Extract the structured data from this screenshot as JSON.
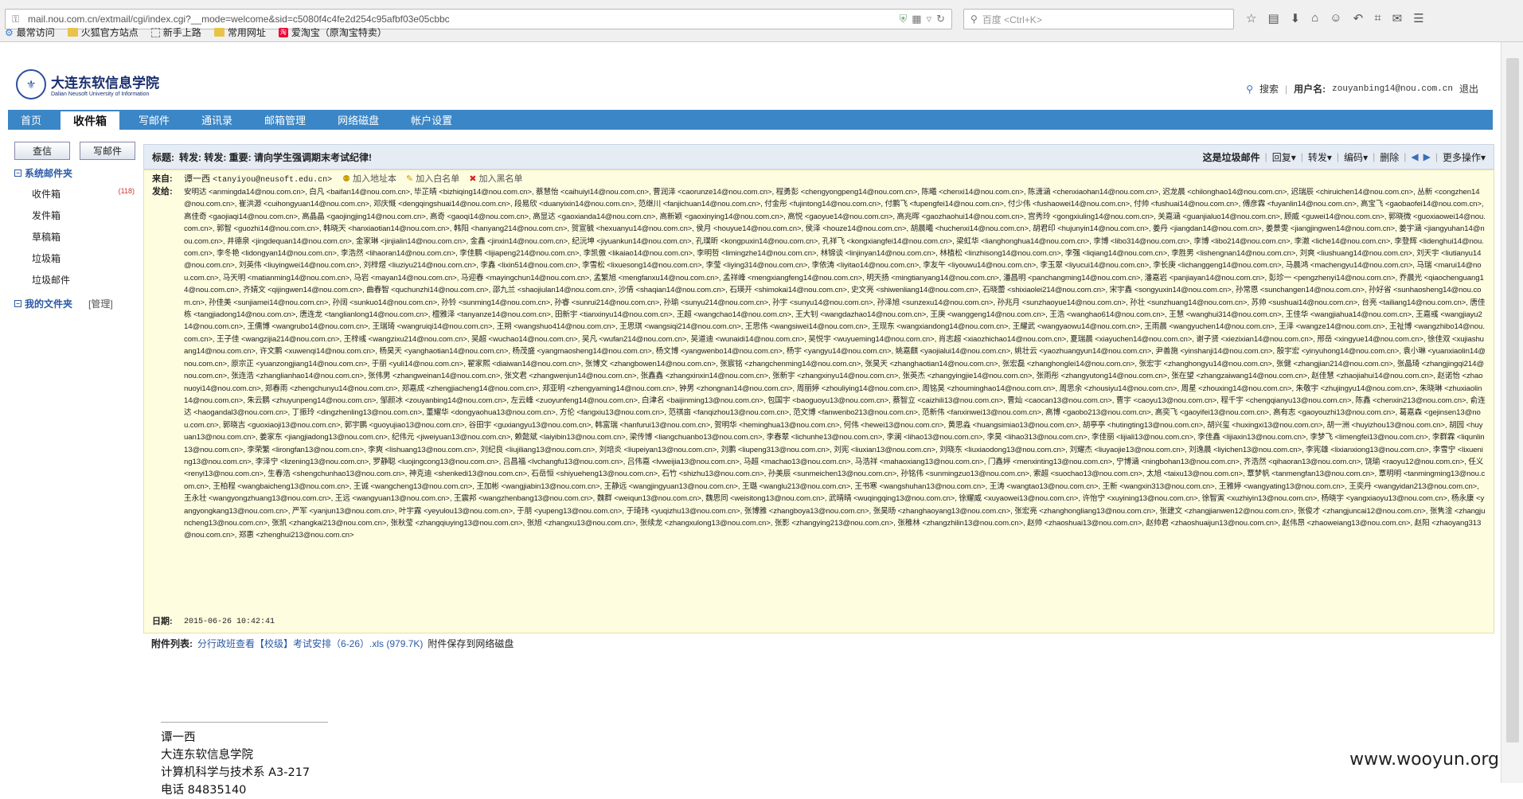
{
  "browser": {
    "url": "mail.nou.com.cn/extmail/cgi/index.cgi?__mode=welcome&sid=c5080f4c4fe2d254c95afbf03e05cbbc",
    "search_placeholder": "百度 <Ctrl+K>",
    "bookmarks": [
      "最常访问",
      "火狐官方站点",
      "新手上路",
      "常用网址",
      "爱淘宝（原淘宝特卖）"
    ]
  },
  "site": {
    "logo_cn": "大连东软信息学院",
    "logo_en": "Dalian Neusoft University of Information",
    "search_label": "搜索",
    "user_label": "用户名:",
    "username": "zouyanbing14@nou.com.cn",
    "logout": "退出"
  },
  "nav": {
    "tabs": [
      "首页",
      "收件箱",
      "写邮件",
      "通讯录",
      "邮箱管理",
      "网络磁盘",
      "帐户设置"
    ]
  },
  "sidebar": {
    "check_btn": "查信",
    "compose_btn": "写邮件",
    "system_title": "系统邮件夹",
    "folders": [
      {
        "name": "收件箱",
        "count": "(118)"
      },
      {
        "name": "发件箱",
        "count": ""
      },
      {
        "name": "草稿箱",
        "count": ""
      },
      {
        "name": "垃圾箱",
        "count": ""
      },
      {
        "name": "垃圾邮件",
        "count": ""
      }
    ],
    "my_title": "我的文件夹",
    "manage": "[管理]"
  },
  "mail": {
    "subject_label": "标题:",
    "subject": "转发: 转发: 重要: 请向学生强调期末考试纪律!",
    "tools": {
      "spam": "这是垃圾邮件",
      "reply": "回复",
      "forward": "转发",
      "encoding": "编码",
      "delete": "删除",
      "more": "更多操作"
    },
    "from_label": "来自:",
    "from_name": "谭一西",
    "from_email": "<tanyiyou@neusoft.edu.cn>",
    "add_contact": "加入地址本",
    "add_white": "加入白名单",
    "add_black": "加入黑名单",
    "to_label": "发给:",
    "recipients_text": "安明达 <anmingda14@nou.com.cn>, 白凡 <baifan14@nou.com.cn>, 毕芷晴 <bizhiqing14@nou.com.cn>, 蔡慧怡 <caihuiyi14@nou.com.cn>, 曹润泽 <caorunze14@nou.com.cn>, 程勇彭 <chengyongpeng14@nou.com.cn>, 陈曦 <chenxi14@nou.com.cn>, 陈潇涵 <chenxiaohan14@nou.com.cn>, 迟龙晨 <chilonghao14@nou.com.cn>, 迟瑞辰 <chiruichen14@nou.com.cn>, 丛新 <congzhen14@nou.com.cn>, 崔洪源 <cuihongyuan14@nou.com.cn>, 邓庆慨 <dengqingshuai14@nou.com.cn>, 段易欣 <duanyixin14@nou.com.cn>, 范继川 <fanjichuan14@nou.com.cn>, 付金彤 <fujintong14@nou.com.cn>, 付鹏飞 <fupengfei14@nou.com.cn>, 付少伟 <fushaowei14@nou.com.cn>, 付帅 <fushuai14@nou.com.cn>, 傅彦霖 <fuyanlin14@nou.com.cn>, 高宝飞 <gaobaofei14@nou.com.cn>, 高佳奇 <gaojiaqi14@nou.com.cn>, 高晶晶 <gaojingjing14@nou.com.cn>, 高奇 <gaoqi14@nou.com.cn>, 高显达 <gaoxianda14@nou.com.cn>, 高新颖 <gaoxinying14@nou.com.cn>, 高悦 <gaoyue14@nou.com.cn>, 高兆晖 <gaozhaohui14@nou.com.cn>, 宫秀玲 <gongxiuling14@nou.com.cn>, 关嘉涵 <guanjialuo14@nou.com.cn>, 顾威 <guwei14@nou.com.cn>, 郭晓微 <guoxiaowei14@nou.com.cn>, 郭智 <guozhi14@nou.com.cn>, 韩晓天 <hanxiaotian14@nou.com.cn>, 韩阳 <hanyang214@nou.com.cn>, 贺宣毓 <hexuanyu14@nou.com.cn>, 侯月 <houyue14@nou.com.cn>, 侯泽 <houze14@nou.com.cn>, 胡晨曦 <huchenxi14@nou.com.cn>, 胡君印 <hujunyin14@nou.com.cn>, 姜丹 <jiangdan14@nou.com.cn>, 姜景雯 <jiangjingwen14@nou.com.cn>, 姜宇涵 <jiangyuhan14@nou.com.cn>, 井德泉 <jingdequan14@nou.com.cn>, 金家琳 <jinjialin14@nou.com.cn>, 金鑫 <jinxin14@nou.com.cn>, 纪沅坤 <jiyuankun14@nou.com.cn>, 孔璞昕 <kongpuxin14@nou.com.cn>, 孔祥飞 <kongxiangfei14@nou.com.cn>, 梁虹华 <lianghonghua14@nou.com.cn>, 李博 <libo314@nou.com.cn>, 李博 <libo214@nou.com.cn>, 李澈 <liche14@nou.com.cn>, 李登辉 <lidenghui14@nou.com.cn>, 李冬艳 <lidongyan14@nou.com.cn>, 李浩然 <lihaoran14@nou.com.cn>, 李佳鹏 <lijiapeng214@nou.com.cn>, 李凯傲 <likaiao14@nou.com.cn>, 李明哲 <limingzhe14@nou.com.cn>, 林锦谈 <linjinyan14@nou.com.cn>, 林植松 <linzhisong14@nou.com.cn>, 李强 <liqiang14@nou.com.cn>, 李胜男 <lishengnan14@nou.com.cn>, 刘爽 <liushuang14@nou.com.cn>, 刘天宇 <liutianyu14@nou.com.cn>, 刘英伟 <liuyingwei14@nou.com.cn>, 刘梓煜 <liuziyu214@nou.com.cn>, 李鑫 <lixin514@nou.com.cn>, 李雪松 <lixuesong14@nou.com.cn>, 李莹 <liying314@nou.com.cn>, 李依涛 <liyitao14@nou.com.cn>, 李友午 <liyouwu14@nou.com.cn>, 李玉翠 <liyucui14@nou.com.cn>, 李长庚 <lichanggeng14@nou.com.cn>, 马晨鸿 <machengyu14@nou.com.cn>, 马瑞 <marui14@nou.com.cn>, 马天明 <matianming14@nou.com.cn>, 马岩 <mayan14@nou.com.cn>, 马迎春 <mayingchun14@nou.com.cn>, 孟繁旭 <mengfanxu14@nou.com.cn>, 孟祥峰 <mengxiangfeng14@nou.com.cn>, 明天扬 <mingtianyang14@nou.com.cn>, 潘昌明 <panchangming14@nou.com.cn>, 潘嘉岩 <panjiayan14@nou.com.cn>, 彭珍一 <pengzhenyi14@nou.com.cn>, 乔晨光 <qiaochenguang14@nou.com.cn>, 齐婧文 <qijingwen14@nou.com.cn>, 曲春智 <quchunzhi14@nou.com.cn>, 邵九兰 <shaojiulan14@nou.com.cn>, 沙倩 <shaqian14@nou.com.cn>, 石瑛开 <shimokai14@nou.com.cn>, 史文亮 <shiwenliang14@nou.com.cn>, 石晓蕾 <shixiaolei214@nou.com.cn>, 宋宇鑫 <songyuxin14@nou.com.cn>, 孙常恩 <sunchangen14@nou.com.cn>, 孙好省 <sunhaosheng14@nou.com.cn>, 孙佳美 <sunjiamei14@nou.com.cn>, 孙阔 <sunkuo14@nou.com.cn>, 孙铃 <sunming14@nou.com.cn>, 孙睿 <sunrui214@nou.com.cn>, 孙瑜 <sunyu214@nou.com.cn>, 孙宇 <sunyu14@nou.com.cn>, 孙泽旭 <sunzexu14@nou.com.cn>, 孙兆月 <sunzhaoyue14@nou.com.cn>, 孙壮 <sunzhuang14@nou.com.cn>, 苏帅 <sushuai14@nou.com.cn>, 台亮 <tailiang14@nou.com.cn>, 唐佳栋 <tangjiadong14@nou.com.cn>, 唐连龙 <tanglianlong14@nou.com.cn>, 檀雅泽 <tanyanze14@nou.com.cn>, 田新宇 <tianxinyu14@nou.com.cn>, 王超 <wangchao14@nou.com.cn>, 王大钊 <wangdazhao14@nou.com.cn>, 王庚 <wanggeng14@nou.com.cn>, 王浩 <wanghao614@nou.com.cn>, 王慧 <wanghui314@nou.com.cn>, 王佳华 <wangjiahua14@nou.com.cn>, 王嘉彧 <wangjiayu214@nou.com.cn>, 王儒博 <wangrubo14@nou.com.cn>, 王瑞琦 <wangruiqi14@nou.com.cn>, 王朔 <wangshuo414@nou.com.cn>, 王思琪 <wangsiqi214@nou.com.cn>, 王思伟 <wangsiwei14@nou.com.cn>, 王现东 <wangxiandong14@nou.com.cn>, 王耀武 <wangyaowu14@nou.com.cn>, 王雨晨 <wangyuchen14@nou.com.cn>, 王泽 <wangze14@nou.com.cn>, 王祉博 <wangzhibo14@nou.com.cn>, 王子佳 <wangzijia214@nou.com.cn>, 王梓彧 <wangzixu214@nou.com.cn>, 吴超 <wuchao14@nou.com.cn>, 吴凡 <wufan214@nou.com.cn>, 吴道迪 <wunaidi14@nou.com.cn>, 吴悦宇 <wuyueming14@nou.com.cn>, 肖志超 <xiaozhichao14@nou.com.cn>, 夏瑞晨 <xiayuchen14@nou.com.cn>, 谢子贤 <xiezixian14@nou.com.cn>, 邢岳 <xingyue14@nou.com.cn>, 徐佳双 <xujiashuang14@nou.com.cn>, 许文鹏 <xuwenqi14@nou.com.cn>, 杨昊天 <yanghaotian14@nou.com.cn>, 杨茂盛 <yangmaosheng14@nou.com.cn>, 杨文博 <yangwenbo14@nou.com.cn>, 杨宇 <yangyu14@nou.com.cn>, 姚嘉麒 <yaojialui14@nou.com.cn>, 姚壮云 <yaozhuangyun14@nou.com.cn>, 尹善施 <yinshanji14@nou.com.cn>, 殷宇宏 <yinyuhong14@nou.com.cn>, 袁小琳 <yuanxiaolin14@nou.com.cn>, 原宗正 <yuanzongjiang14@nou.com.cn>, 于丽 <yuli14@nou.com.cn>, 翟家熙 <diaiwan14@nou.com.cn>, 张博文 <zhangbowen14@nou.com.cn>, 张宸铭 <zhangchenming14@nou.com.cn>, 张昊天 <zhanghaotian14@nou.com.cn>, 张宏磊 <zhanghonglei14@nou.com.cn>, 张宏宇 <zhanghongyu14@nou.com.cn>, 张健 <zhangjian214@nou.com.cn>, 张晶琦 <zhangjingqi214@nou.com.cn>, 张连浩 <zhanglianhao14@nou.com.cn>, 张伟男 <zhangweinan14@nou.com.cn>, 张文君 <zhangwenjun14@nou.com.cn>, 张鑫鑫 <zhangxinxin14@nou.com.cn>, 张新宇 <zhangxinyu14@nou.com.cn>, 张英杰 <zhangyingjie14@nou.com.cn>, 张雨彤 <zhangyutong14@nou.com.cn>, 张在望 <zhangzaiwang14@nou.com.cn>, 赵佳慧 <zhaojiahui14@nou.com.cn>, 赵诺怡 <zhaonuoyi14@nou.com.cn>, 郑春雨 <zhengchunyu14@nou.com.cn>, 郑嘉成 <zhengjiacheng14@nou.com.cn>, 郑亚明 <zhengyaming14@nou.com.cn>, 钟男 <zhongnan14@nou.com.cn>, 周丽婷 <zhouliying14@nou.com.cn>, 周铭昊 <zhouminghao14@nou.com.cn>, 周思余 <zhousiyu14@nou.com.cn>, 周星 <zhouxing14@nou.com.cn>, 朱敬宇 <zhujingyu14@nou.com.cn>, 朱晓琳 <zhuxiaolin14@nou.com.cn>, 朱云鹏 <zhuyunpeng14@nou.com.cn>, 邹颜冰 <zouyanbing14@nou.com.cn>, 左云峰 <zuoyunfeng14@nou.com.cn>, 白津名 <baijinming13@nou.com.cn>, 包国宇 <baoguoyu13@nou.com.cn>, 蔡智立 <caizhili13@nou.com.cn>, 曹灿 <caocan13@nou.com.cn>, 曹宇 <caoyu13@nou.com.cn>, 程千宇 <chengqianyu13@nou.com.cn>, 陈鑫 <chenxin213@nou.com.cn>, 俞连达 <haogandal3@nou.com.cn>, 丁振玲 <dingzhenling13@nou.com.cn>, 董耀华 <dongyaohua13@nou.com.cn>, 方伦 <fangxiu13@nou.com.cn>, 范祺亩 <fanqizhou13@nou.com.cn>, 范文博 <fanwenbo213@nou.com.cn>, 范新伟 <fanxinwei13@nou.com.cn>, 高博 <gaobo213@nou.com.cn>, 高奕飞 <gaoyifei13@nou.com.cn>, 高有志 <gaoyouzhi13@nou.com.cn>, 葛嘉森 <gejinsen13@nou.com.cn>, 郭晓吉 <guoxiaoji13@nou.com.cn>, 郭宇鹏 <guoyujiao13@nou.com.cn>, 谷田宇 <guxiangyu13@nou.com.cn>, 韩富瑞 <hanfurui13@nou.com.cn>, 贺明华 <heminghua13@nou.com.cn>, 何伟 <hewei13@nou.com.cn>, 黄思淼 <huangsimiao13@nou.com.cn>, 胡亭亭 <hutingting13@nou.com.cn>, 胡兴玺 <huxingxi13@nou.com.cn>, 胡一洲 <huyizhou13@nou.com.cn>, 胡园 <huyuan13@nou.com.cn>, 姜家东 <jiangjiadong13@nou.com.cn>, 纪伟元 <jiweiyuan13@nou.com.cn>, 赖懿斌 <laiyibin13@nou.com.cn>, 梁传博 <liangchuanbo13@nou.com.cn>, 李春翠 <lichunhe13@nou.com.cn>, 李澜 <lihao13@nou.com.cn>, 李昊 <lihao313@nou.com.cn>, 李佳丽 <lijiali13@nou.com.cn>, 李佳鑫 <lijiaxin13@nou.com.cn>, 李梦飞 <limengfei13@nou.com.cn>, 李群霖 <liqunlin13@nou.com.cn>, 李荣繁 <lirongfan13@nou.com.cn>, 李爽 <lishuang13@nou.com.cn>, 刘纪良 <liujiliang13@nou.com.cn>, 刘培炎 <liupeiyan13@nou.com.cn>, 刘鹏 <liupeng313@nou.com.cn>, 刘宪 <liuxian13@nou.com.cn>, 刘晓东 <liuxiaodong13@nou.com.cn>, 刘耀杰 <liuyaojie13@nou.com.cn>, 刘逸晨 <liyichen13@nou.com.cn>, 李宪雄 <lixianxiong13@nou.com.cn>, 李雪宁 <lixuening13@nou.com.cn>, 李泽宁 <lizening13@nou.com.cn>, 罗静聪 <luojingcong13@nou.com.cn>, 吕昌福 <lvchangfu13@nou.com.cn>, 吕伟嘉 <lvweijia13@nou.com.cn>, 马超 <machao13@nou.com.cn>, 马浩祥 <mahaoxiang13@nou.com.cn>, 门鑫婷 <menxinting13@nou.com.cn>, 宁博涵 <ningbohan13@nou.com.cn>, 齐浩然 <qihaoran13@nou.com.cn>, 饶瑜 <raoyu12@nou.com.cn>, 任义 <renyi13@nou.com.cn>, 生春浩 <shengchunhao13@nou.com.cn>, 神克迪 <shenkedi13@nou.com.cn>, 石岳恒 <shiyueheng13@nou.com.cn>, 石竹 <shizhu13@nou.com.cn>, 孙美辰 <sunmeichen13@nou.com.cn>, 孙铭伟 <sunmingzuo13@nou.com.cn>, 索超 <suochao13@nou.com.cn>, 太旭 <taixu13@nou.com.cn>, 覃梦帆 <tanmengfan13@nou.com.cn>, 覃明明 <tanmingming13@nou.com.cn>, 王柏程 <wangbaicheng13@nou.com.cn>, 王诚 <wangcheng13@nou.com.cn>, 王加彬 <wangjiabin13@nou.com.cn>, 王静远 <wangjingyuan13@nou.com.cn>, 王璐 <wanglu213@nou.com.cn>, 王书寒 <wangshuhan13@nou.com.cn>, 王涛 <wangtao13@nou.com.cn>, 王新 <wangxin313@nou.com.cn>, 王雅婷 <wangyating13@nou.com.cn>, 王奕丹 <wangyidan213@nou.com.cn>, 王永壮 <wangyongzhuang13@nou.com.cn>, 王远 <wangyuan13@nou.com.cn>, 王震邦 <wangzhenbang13@nou.com.cn>, 魏群 <weiqun13@nou.com.cn>, 魏思同 <weisitong13@nou.com.cn>, 武晴晴 <wuqingqing13@nou.com.cn>, 徐耀威 <xuyaowei13@nou.com.cn>, 许怡宁 <xuyining13@nou.com.cn>, 徐智寅 <xuzhiyin13@nou.com.cn>, 杨晓宇 <yangxiaoyu13@nou.com.cn>, 杨永康 <yangyongkang13@nou.com.cn>, 严军 <yanjun13@nou.com.cn>, 叶宇露 <yeyulou13@nou.com.cn>, 于朋 <yupeng13@nou.com.cn>, 于琦玮 <yuqizhu13@nou.com.cn>, 张博雅 <zhangboya13@nou.com.cn>, 张昊旸 <zhanghaoyang13@nou.com.cn>, 张宏亮 <zhanghongliang13@nou.com.cn>, 张建文 <zhangjianwen12@nou.com.cn>, 张俊才 <zhangjuncai12@nou.com.cn>, 张隽淦 <zhangjuncheng13@nou.com.cn>, 张凯 <zhangkai213@nou.com.cn>, 张秋莹 <zhangqiuying13@nou.com.cn>, 张旭 <zhangxu13@nou.com.cn>, 张续龙 <zhangxulong13@nou.com.cn>, 张影 <zhangying213@nou.com.cn>, 张稚林 <zhangzhilin13@nou.com.cn>, 赵帅 <zhaoshuai13@nou.com.cn>, 赵帅君 <zhaoshuaijun13@nou.com.cn>, 赵伟昂 <zhaoweiang13@nou.com.cn>, 赵阳 <zhaoyang313@nou.com.cn>, 郑惠 <zhenghui213@nou.com.cn>",
    "date_label": "日期:",
    "date": "2015-06-26 10:42:41",
    "attach_label": "附件列表:",
    "attach_name": "分行政班查看【校级】考试安排（6-26）.xls (979.7K)",
    "attach_save": "附件保存到网络磁盘",
    "signature": [
      "谭一西",
      "大连东软信息学院",
      "计算机科学与技术系 A3-217",
      "电话  84835140"
    ]
  },
  "watermark": "www.wooyun.org"
}
